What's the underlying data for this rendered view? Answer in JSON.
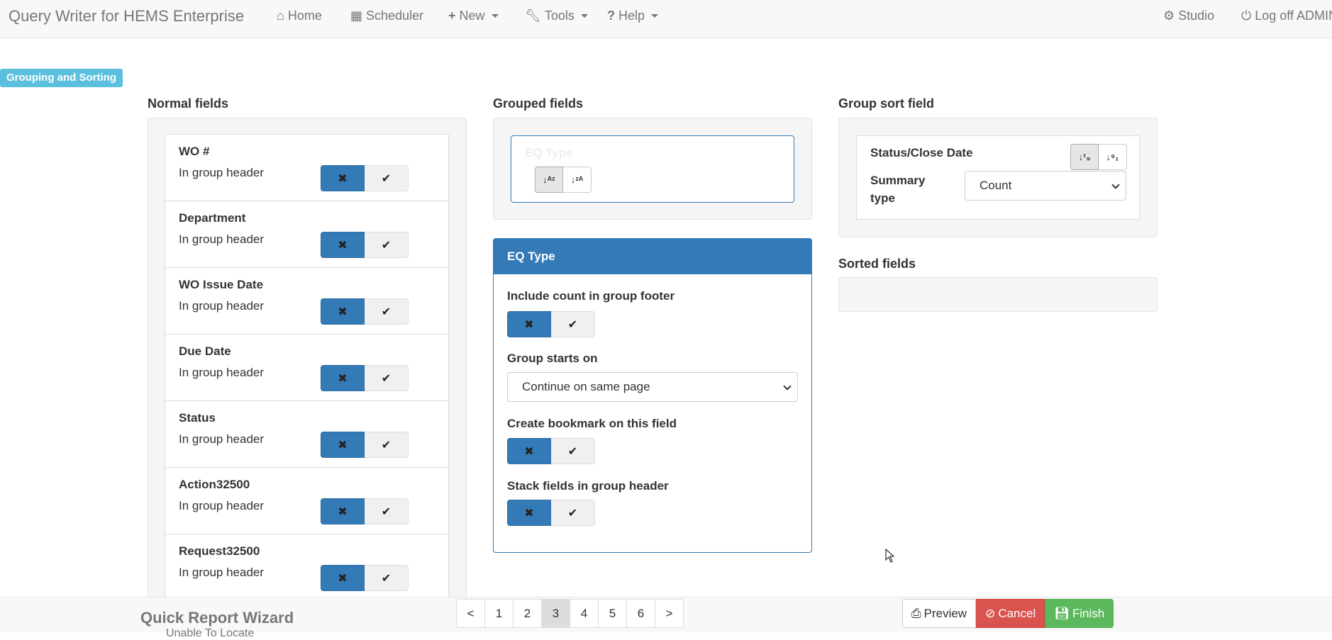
{
  "navbar": {
    "brand": "Query Writer for HEMS Enterprise",
    "home": "Home",
    "scheduler": "Scheduler",
    "new": "New",
    "tools": "Tools",
    "help": "Help",
    "studio": "Studio",
    "logoff": "Log off ADMIN"
  },
  "section_label": "Grouping and Sorting",
  "normal_fields": {
    "title": "Normal fields",
    "items": [
      {
        "name": "WO #",
        "sub": "In group header"
      },
      {
        "name": "Department",
        "sub": "In group header"
      },
      {
        "name": "WO Issue Date",
        "sub": "In group header"
      },
      {
        "name": "Due Date",
        "sub": "In group header"
      },
      {
        "name": "Status",
        "sub": "In group header"
      },
      {
        "name": "Action32500",
        "sub": "In group header"
      },
      {
        "name": "Request32500",
        "sub": "In group header"
      }
    ]
  },
  "grouped_fields": {
    "title": "Grouped fields",
    "item": "EQ Type"
  },
  "panel": {
    "title": "EQ Type",
    "include_count": "Include count in group footer",
    "group_starts_on": "Group starts on",
    "group_starts_value": "Continue on same page",
    "create_bookmark": "Create bookmark on this field",
    "stack_fields": "Stack fields in group header"
  },
  "group_sort": {
    "title": "Group sort field",
    "field": "Status/Close Date",
    "summary_label_1": "Summary",
    "summary_label_2": "type",
    "summary_value": "Count"
  },
  "sorted_fields": {
    "title": "Sorted fields"
  },
  "footer": {
    "title": "Quick Report Wizard",
    "subtitle": "Unable To Locate",
    "pages": [
      "<",
      "1",
      "2",
      "3",
      "4",
      "5",
      "6",
      ">"
    ],
    "active_page": "3",
    "preview": "Preview",
    "cancel": "Cancel",
    "finish": "Finish"
  }
}
